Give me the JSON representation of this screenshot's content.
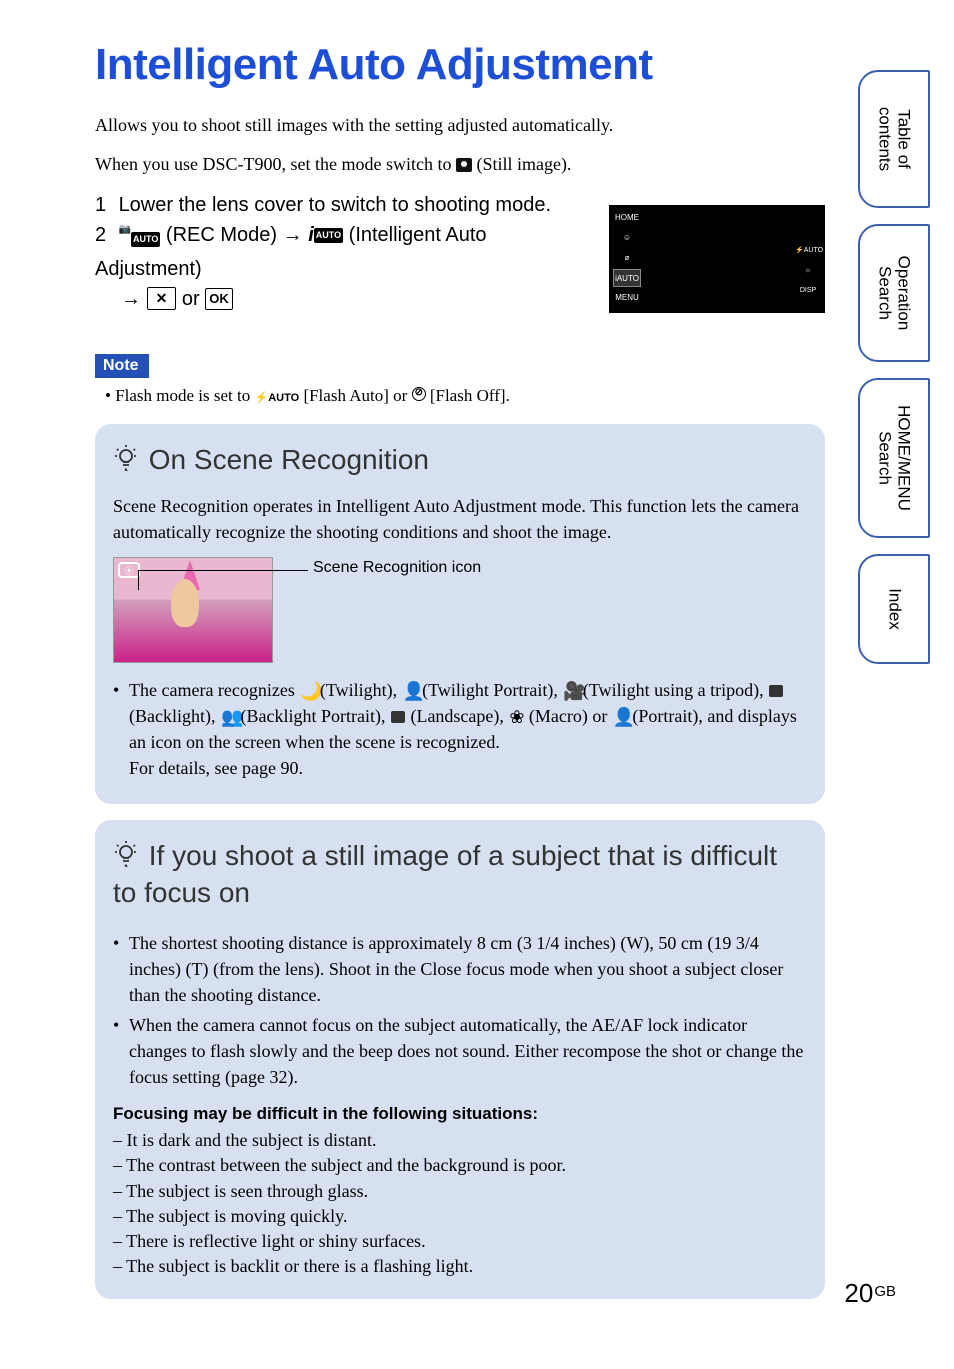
{
  "title": "Intelligent Auto Adjustment",
  "intro1": "Allows you to shoot still images with the setting adjusted automatically.",
  "intro2_pre": "When you use DSC-T900, set the mode switch to ",
  "intro2_post": " (Still image).",
  "step1": "Lower the lens cover to switch to shooting mode.",
  "step2_a": "(REC Mode) ",
  "step2_b": " (Intelligent Auto Adjustment) ",
  "step2_or": " or ",
  "arrow": "→",
  "btn_x": "✕",
  "btn_ok": "OK",
  "note_label": "Note",
  "note_bullet": "•",
  "note_text_a": " Flash mode is set to ",
  "note_text_b": " [Flash Auto] or ",
  "note_text_c": " [Flash Off].",
  "flash_auto_icon": "⚡AUTO",
  "tip1_title": "On Scene Recognition",
  "tip1_body": "Scene Recognition operates in Intelligent Auto Adjustment mode. This function lets the camera automatically recognize the shooting conditions and shoot the image.",
  "scene_caption": "Scene Recognition icon",
  "tip1_rec_a": "The camera recognizes ",
  "tip1_rec_items": " (Twilight),   (Twilight Portrait),   (Twilight using a tripod),   (Backlight),   (Backlight Portrait),   (Landscape),   (Macro) or   (Portrait), and displays an icon on the screen when the scene is recognized.",
  "tip1_rec_detail": "For details, see page 90.",
  "tip2_title": "If you shoot a still image of a subject that is difficult to focus on",
  "tip2_b1": "The shortest shooting distance is approximately 8 cm (3 1/4 inches) (W), 50 cm (19 3/4 inches) (T) (from the lens). Shoot in the Close focus mode when you shoot a subject closer than the shooting distance.",
  "tip2_b2": "When the camera cannot focus on the subject automatically, the AE/AF lock indicator changes to flash slowly and the beep does not sound. Either recompose the shot or change the focus setting (page 32).",
  "focus_heading": "Focusing may be difficult in the following situations:",
  "focus_items": [
    "– It is dark and the subject is distant.",
    "– The contrast between the subject and the background is poor.",
    "– The subject is seen through glass.",
    "– The subject is moving quickly.",
    "– There is reflective light or shiny surfaces.",
    "– The subject is backlit or there is a flashing light."
  ],
  "page_number": "20",
  "page_suffix": "GB",
  "tabs": [
    "Table of\ncontents",
    "Operation\nSearch",
    "HOME/MENU\nSearch",
    "Index"
  ],
  "cam_left": [
    "HOME",
    "☺",
    "⌀",
    "iAUTO",
    "MENU"
  ],
  "cam_right": [
    "⚡AUTO",
    "☼",
    "DISP"
  ]
}
